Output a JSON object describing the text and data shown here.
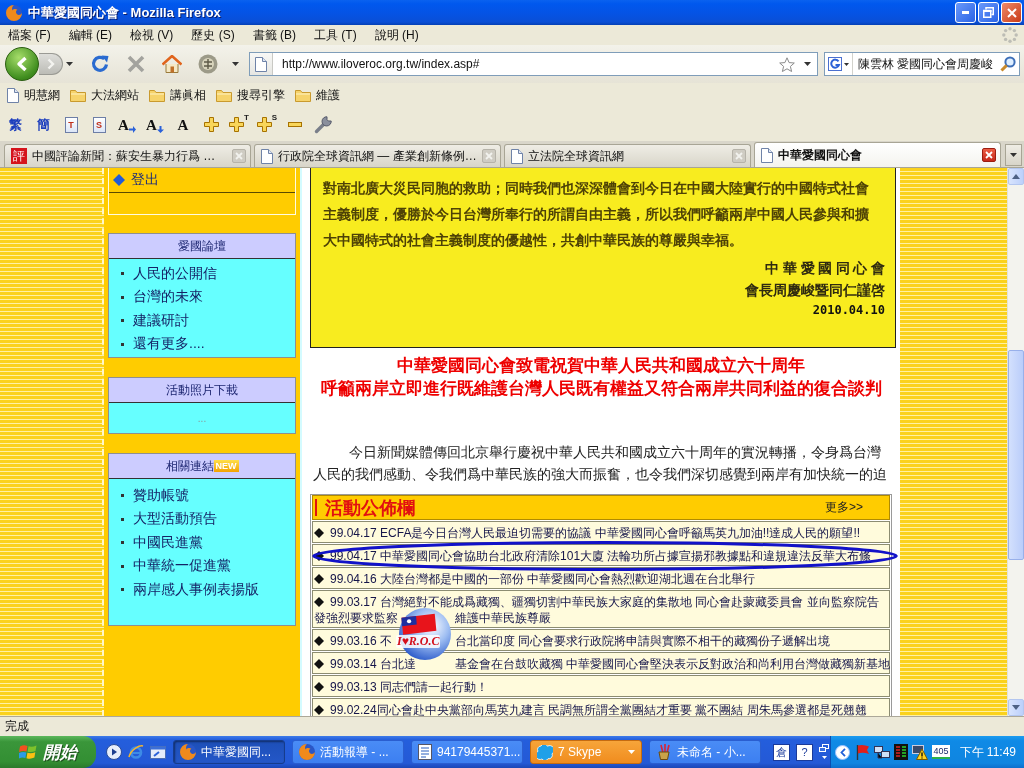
{
  "window": {
    "title": "中華愛國同心會 - Mozilla Firefox"
  },
  "menu": [
    "檔案 (F)",
    "編輯 (E)",
    "檢視 (V)",
    "歷史 (S)",
    "書籤 (B)",
    "工具 (T)",
    "說明 (H)"
  ],
  "navigation": {
    "back_enabled": true,
    "forward_enabled": false,
    "stop_enabled": false,
    "url": "http://www.iloveroc.org.tw/index.asp#",
    "bookmarked": false,
    "search_value": "陳雲林 愛國同心會周慶峻"
  },
  "bookmarks": [
    {
      "kind": "page",
      "label": "明慧網"
    },
    {
      "kind": "folder",
      "label": "大法網站"
    },
    {
      "kind": "folder",
      "label": "講眞相"
    },
    {
      "kind": "folder",
      "label": "搜尋引擎"
    },
    {
      "kind": "folder",
      "label": "維護"
    }
  ],
  "converter_toolbar": [
    {
      "kind": "text",
      "label": "繁"
    },
    {
      "kind": "text",
      "label": "簡"
    },
    {
      "kind": "doc",
      "label": "T"
    },
    {
      "kind": "doc",
      "label": "S"
    },
    {
      "kind": "font_right",
      "label": "A"
    },
    {
      "kind": "font_down",
      "label": "A"
    },
    {
      "kind": "font",
      "label": "A"
    },
    {
      "kind": "plus"
    },
    {
      "kind": "plus",
      "label": "T"
    },
    {
      "kind": "plus",
      "label": "S"
    },
    {
      "kind": "minus"
    },
    {
      "kind": "tool"
    }
  ],
  "tabs": [
    {
      "kind": "badge",
      "icon_text": "評",
      "label": "中國評論新聞：蘇安生暴力行爲 …",
      "selected": false
    },
    {
      "kind": "page",
      "label": "行政院全球資訊網 — 產業創新條例…",
      "selected": false
    },
    {
      "kind": "page",
      "label": "立法院全球資訊網",
      "selected": false
    },
    {
      "kind": "page",
      "label": "中華愛國同心會",
      "selected": true
    }
  ],
  "sidebar": {
    "logout": "登出",
    "sections": [
      {
        "title": "愛國論壇",
        "items": [
          "人民的公開信",
          "台灣的未來",
          "建議研討",
          "還有更多...."
        ]
      },
      {
        "title": "活動照片下載",
        "note": "..."
      },
      {
        "title": "相關連結",
        "badge": "NEW",
        "items": [
          "贊助帳號",
          "大型活動預告",
          "中國民進黨",
          "中華統一促進黨",
          "兩岸感人事例表揚版"
        ]
      }
    ]
  },
  "letter": {
    "text": "對南北廣大災民同胞的救助；同時我們也深深體會到今日在中國大陸實行的中國特式社會主義制度，優勝於今日台灣所奉行的所謂自由主義，所以我們呼籲兩岸中國人民參與和擴大中國特式的社會主義制度的優越性，共創中華民族的尊嚴與幸福。",
    "signature": [
      "中 華 愛 國 同 心 會",
      "會長周慶峻暨同仁謹啓"
    ],
    "date": "2010.04.10"
  },
  "article": {
    "headline": [
      "中華愛國同心會致電祝賀中華人民共和國成立六十周年",
      "呼籲兩岸立即進行既維護台灣人民既有權益又符合兩岸共同利益的復合談判"
    ],
    "body": "今日新聞媒體傳回北京舉行慶祝中華人民共和國成立六十周年的實況轉播，令身爲台灣人民的我們感動、令我們爲中華民族的強大而振奮，也令我們深切感覺到兩岸有加快統一的迫"
  },
  "notice_board": {
    "title": "活動公佈欄",
    "more": "更多>>",
    "rows": [
      {
        "lines": [
          [
            "99.04.17 ECFA是今日台灣人民最迫切需要的協議 中華愛國同心會呼籲馬英九加油!!達成人民的願望!!"
          ]
        ],
        "circled": false
      },
      {
        "lines": [
          [
            "99.04.17 中華愛國同心會協助台北政府清除101大廈 法輪功所占據宣揚邪教據點和違規違法反華大布條"
          ]
        ],
        "circled": true
      },
      {
        "lines": [
          [
            "99.04.16 大陸台灣都是中國的一部份 中華愛國同心會熱烈歡迎湖北週在台北舉行"
          ]
        ],
        "circled": false
      },
      {
        "lines": [
          [
            "99.03.17 台灣絕對不能成爲藏獨、疆獨切割中華民族大家庭的集散地 同心會赴蒙藏委員會 並向監察院告"
          ],
          [
            "發強烈要求監察",
            "維護中華民族尊嚴"
          ]
        ],
        "circled": false
      },
      {
        "lines": [
          [
            "99.03.16 不",
            "台北當印度 同心會要求行政院將申請與實際不相干的藏獨份子遞解出境"
          ]
        ],
        "circled": false
      },
      {
        "lines": [
          [
            "99.03.14 台北達",
            "基金會在台鼓吹藏獨 中華愛國同心會堅決表示反對政治和尚利用台灣做藏獨新基地"
          ]
        ],
        "circled": false
      },
      {
        "lines": [
          [
            "99.03.13 同志們請一起行動！"
          ]
        ],
        "circled": false
      },
      {
        "lines": [
          [
            "99.02.24同心會赴中央黨部向馬英九建言 民調無所謂全黨團結才重要 黨不團結 周朱馬參選都是死翹翹"
          ]
        ],
        "circled": false
      }
    ]
  },
  "overlay_logo": {
    "text": "I♥R.O.C"
  },
  "status_bar": {
    "text": "完成"
  },
  "taskbar": {
    "start": "開始",
    "tasks": [
      {
        "kind": "browser",
        "label": "中華愛國同...",
        "selected": true,
        "flashing": false,
        "grouped": false
      },
      {
        "kind": "browser",
        "label": "活動報導 - ...",
        "selected": false,
        "flashing": false,
        "grouped": false
      },
      {
        "kind": "document",
        "label": "94179445371...",
        "selected": false,
        "flashing": false,
        "grouped": false
      },
      {
        "kind": "chat",
        "label": "7 Skype",
        "selected": false,
        "flashing": true,
        "grouped": true
      },
      {
        "kind": "paint",
        "label": "未命名 - 小...",
        "selected": false,
        "flashing": false,
        "grouped": false
      }
    ],
    "ime_buttons": [
      "倉",
      "?"
    ],
    "tray_badge": "405",
    "clock": "下午 11:49"
  }
}
